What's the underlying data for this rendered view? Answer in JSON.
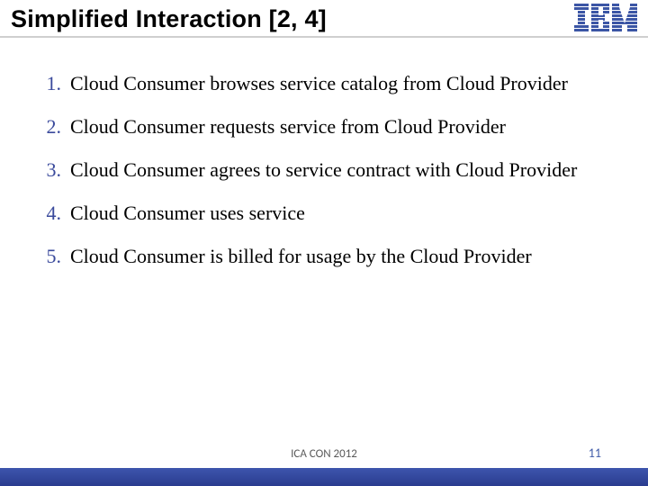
{
  "header": {
    "title": "Simplified Interaction [2, 4]",
    "brand": "IBM"
  },
  "body": {
    "items": [
      {
        "num": "1.",
        "text": "Cloud Consumer browses service catalog from Cloud Provider"
      },
      {
        "num": "2.",
        "text": "Cloud Consumer requests service from Cloud Provider"
      },
      {
        "num": "3.",
        "text": "Cloud Consumer agrees to service contract with Cloud Provider"
      },
      {
        "num": "4.",
        "text": "Cloud Consumer uses service"
      },
      {
        "num": "5.",
        "text": "Cloud Consumer is billed for usage by the Cloud Provider"
      }
    ]
  },
  "footer": {
    "caption": "ICA CON 2012",
    "page": "11"
  }
}
